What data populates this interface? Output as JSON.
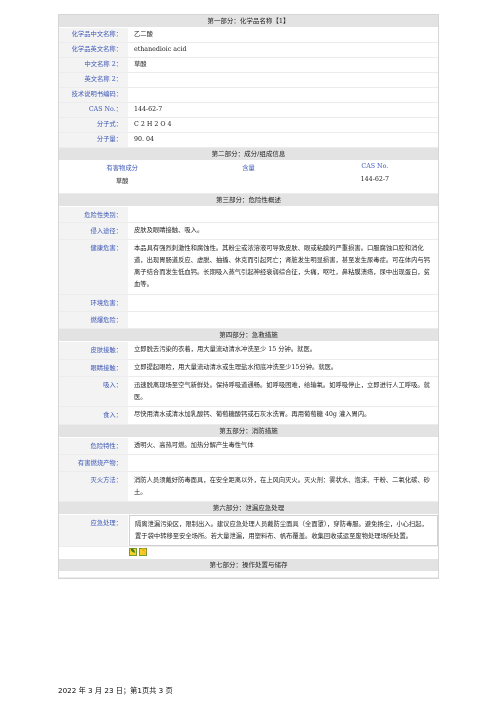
{
  "part1": {
    "header": "第一部分：化学品名称【1】",
    "rows": [
      {
        "label": "化学品中文名称：",
        "value": "乙二酸"
      },
      {
        "label": "化学品英文名称：",
        "value": "ethanedioic acid"
      },
      {
        "label": "中文名称 2：",
        "value": "草酸"
      },
      {
        "label": "英文名称 2：",
        "value": ""
      },
      {
        "label": "技术说明书编码：",
        "value": ""
      },
      {
        "label": "CAS No.：",
        "value": "144-62-7"
      },
      {
        "label": "分子式：",
        "value": "C 2 H 2 O 4"
      },
      {
        "label": "分子量：",
        "value": "90. 04"
      }
    ]
  },
  "part2": {
    "header": "第二部分：成分/组成信息",
    "columns": [
      "有害物成分",
      "含量",
      "CAS No."
    ],
    "row": [
      "草酸",
      "",
      "144-62-7"
    ]
  },
  "part3": {
    "header": "第三部分：危险性概述",
    "rows": [
      {
        "label": "危险性类别：",
        "value": ""
      },
      {
        "label": "侵入途径：",
        "value": "皮肤及眼睛接触、吸入。"
      },
      {
        "label": "健康危害：",
        "value": "本品具有强烈刺激性和腐蚀性。其粉尘或浓溶液可导致皮肤、眼或粘膜的严重损害。口服腐蚀口腔和消化道，出现胃肠道反应、虚脱、抽搐、休克而引起死亡；肾脏发生明显损害，甚至发生尿毒症。可在体内与钙离子结合而发生低血钙。长期吸入蒸气引起神经衰弱综合征，头痛，呕吐，鼻粘膜溃疡，尿中出现蛋白，贫血等。"
      },
      {
        "label": "环境危害：",
        "value": ""
      },
      {
        "label": "燃爆危险：",
        "value": ""
      }
    ]
  },
  "part4": {
    "header": "第四部分：急救措施",
    "rows": [
      {
        "label": "皮肤接触：",
        "value": "立即脱去污染的衣着，用大量流动清水冲洗至少 15 分钟。就医。"
      },
      {
        "label": "眼睛接触：",
        "value": "立即提起眼睑，用大量流动清水或生理盐水彻底冲洗至少15分钟。就医。"
      },
      {
        "label": "吸入：",
        "value": "迅速脱离现场至空气新鲜处。保持呼吸道通畅。如呼吸困难，给输氧。如呼吸停止，立即进行人工呼吸。就医。"
      },
      {
        "label": "食入：",
        "value": "尽快用清水或清水加乳酸钙、葡萄糖酸钙或石灰水洗胃。再用葡萄糖 40g 灌入胃内。"
      }
    ]
  },
  "part5": {
    "header": "第五部分：消防措施",
    "rows": [
      {
        "label": "危险特性：",
        "value": "透明火、高热可燃。加热分解产生毒性气体"
      },
      {
        "label": "有害燃烧产物：",
        "value": ""
      },
      {
        "label": "灭火方法：",
        "value": "消防人员须戴好防毒面具，在安全距离以外，在上风向灭火。灭火剂：雾状水、泡沫、干粉、二氧化碳、砂土。"
      }
    ]
  },
  "part6": {
    "header": "第六部分：泄漏应急处理",
    "rows": [
      {
        "label": "应急处理：",
        "value": "隔离泄漏污染区，限制出入。建议应急处理人员戴防尘面具（全面罩），穿防毒服。避免扬尘，小心扫起，置于袋中转移至安全场所。若大量泄漏，用塑料布、帆布覆盖。收集回收或运至废物处理场所处置。"
      }
    ]
  },
  "part7": {
    "header": "第七部分：操作处置与储存"
  },
  "footer": {
    "text": "2022 年 3 月 23 日；第1页共 3 页"
  }
}
